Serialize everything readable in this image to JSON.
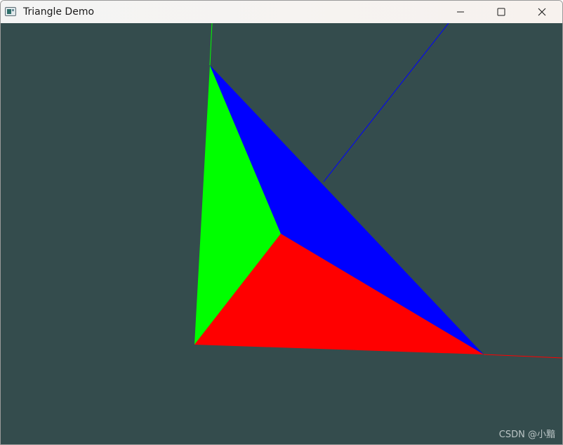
{
  "window": {
    "title": "Triangle Demo"
  },
  "titlebar_buttons": {
    "minimize_icon": "minimize-icon",
    "maximize_icon": "maximize-icon",
    "close_icon": "close-icon"
  },
  "scene": {
    "background_color": "#344c4d",
    "faces": [
      {
        "name": "green-face",
        "color": "#00ff00"
      },
      {
        "name": "blue-face",
        "color": "#0000ff"
      },
      {
        "name": "red-face",
        "color": "#ff0000"
      }
    ],
    "axes": [
      {
        "name": "y-axis-line",
        "color": "#00ff00"
      },
      {
        "name": "z-axis-line",
        "color": "#0000ff"
      },
      {
        "name": "x-axis-line",
        "color": "#ff0000"
      }
    ]
  },
  "watermark": {
    "text": "CSDN @小黯"
  }
}
